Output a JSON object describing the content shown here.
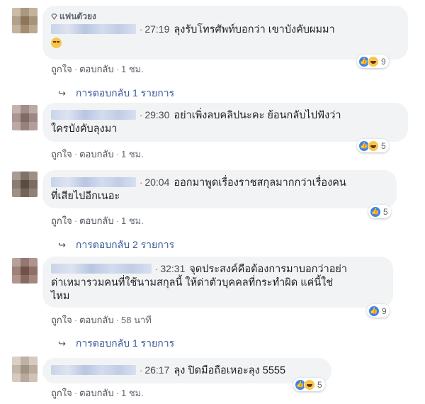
{
  "fan_badge": "แฟนตัวยง",
  "comments": [
    {
      "timestamp": "27:19",
      "text": "ลุงรับโทรศัพท์บอกว่า เขาบังคับผมมา",
      "reaction_count": "9",
      "action_like": "ถูกใจ",
      "action_reply": "ตอบกลับ",
      "time_ago": "1 ชม.",
      "replies": "การตอบกลับ 1 รายการ"
    },
    {
      "timestamp": "29:30",
      "text_line1": "อย่าเพิ่งลบคลิปนะคะ ย้อนกลับไปฟังว่า",
      "text_line2": "ใครบังคับลุงมา",
      "reaction_count": "5",
      "action_like": "ถูกใจ",
      "action_reply": "ตอบกลับ",
      "time_ago": "1 ชม."
    },
    {
      "timestamp": "20:04",
      "text_line1": "ออกมาพูดเรื่องราชสกุลมากกว่าเรื่องคน",
      "text_line2": "ที่เสียไปอีกเนอะ",
      "reaction_count": "5",
      "action_like": "ถูกใจ",
      "action_reply": "ตอบกลับ",
      "time_ago": "1 ชม.",
      "replies": "การตอบกลับ 2 รายการ"
    },
    {
      "timestamp": "32:31",
      "text_line1": "จุดประสงค์คือต้องการมาบอกว่าอย่า",
      "text_line2": "ด่าเหมารวมคนที่ใช้นามสกุลนี้ ให้ด่าตัวบุคคลที่กระทำผิด แค่นี้ใช่",
      "text_line3": "ไหม",
      "reaction_count": "9",
      "action_like": "ถูกใจ",
      "action_reply": "ตอบกลับ",
      "time_ago": "58 นาที",
      "replies": "การตอบกลับ 1 รายการ"
    },
    {
      "timestamp": "26:17",
      "text": "ลุง ปิดมือถือเหอะลุง 5555",
      "reaction_count": "5",
      "action_like": "ถูกใจ",
      "action_reply": "ตอบกลับ",
      "time_ago": "1 ชม."
    }
  ],
  "colors": {
    "bubble": "#f2f3f5",
    "link": "#385898",
    "like_blue": "#3b82f6",
    "haha_yellow": "#f7c64a",
    "timestamp_dot": "#d63b3b"
  }
}
